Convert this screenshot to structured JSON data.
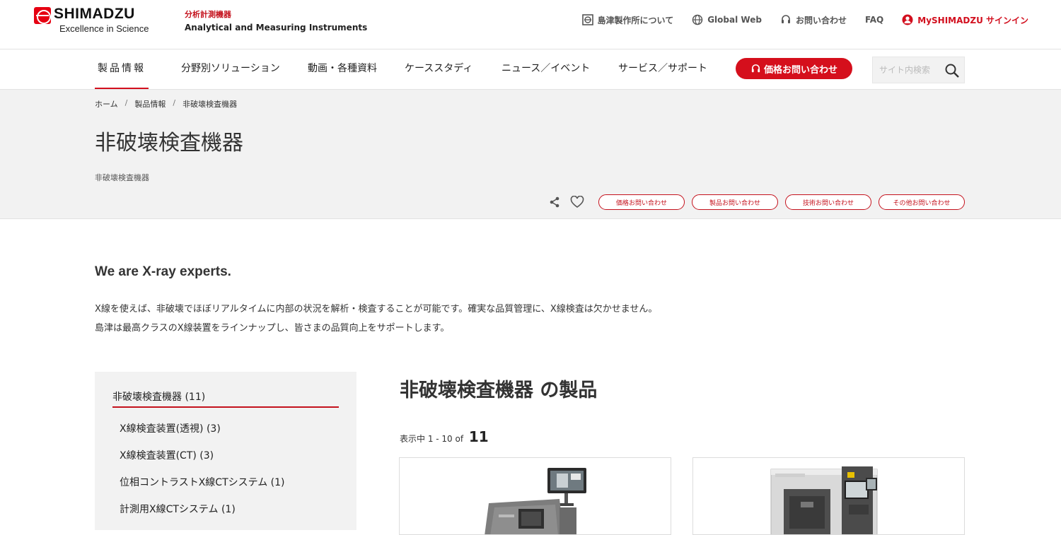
{
  "brand": {
    "logo_text": "SHIMADZU",
    "tagline": "Excellence in Science",
    "division_jp": "分析計測機器",
    "division_en": "Analytical and Measuring Instruments",
    "accent_color": "#d20f1e"
  },
  "util_nav": [
    {
      "label": "島津製作所について",
      "icon": "building-icon"
    },
    {
      "label": "Global Web",
      "icon": "globe-icon"
    },
    {
      "label": "お問い合わせ",
      "icon": "headset-icon"
    },
    {
      "label": "FAQ"
    },
    {
      "label": "MySHIMADZU サインイン",
      "icon": "user-icon"
    }
  ],
  "main_nav": {
    "items": [
      "製品情報",
      "分野別ソリューション",
      "動画・各種資料",
      "ケーススタディ",
      "ニュース／イベント",
      "サービス／サポート"
    ],
    "active_index": 0,
    "price_button": "価格お問い合わせ",
    "search_placeholder": "サイト内検索"
  },
  "breadcrumb": [
    "ホーム",
    "製品情報",
    "非破壊検査機器"
  ],
  "page": {
    "title": "非破壊検査機器",
    "subtitle": "非破壊検査機器",
    "inquiry_buttons": [
      "価格お問い合わせ",
      "製品お問い合わせ",
      "技術お問い合わせ",
      "その他お問い合わせ"
    ]
  },
  "intro": {
    "heading": "We are X-ray experts.",
    "line1": "X線を使えば、非破壊でほぼリアルタイムに内部の状況を解析・検査することが可能です。確実な品質管理に、X線検査は欠かせません。",
    "line2": "島津は最高クラスのX線装置をラインナップし、皆さまの品質向上をサポートします。"
  },
  "sidebar": {
    "title": "非破壊検査機器 (11)",
    "items": [
      "X線検査装置(透視) (3)",
      "X線検査装置(CT) (3)",
      "位相コントラストX線CTシステム (1)",
      "計測用X線CTシステム (1)"
    ]
  },
  "products": {
    "heading": "非破壊検査機器 の製品",
    "count_prefix": "表示中 1 - 10 of",
    "count_total": "11"
  }
}
